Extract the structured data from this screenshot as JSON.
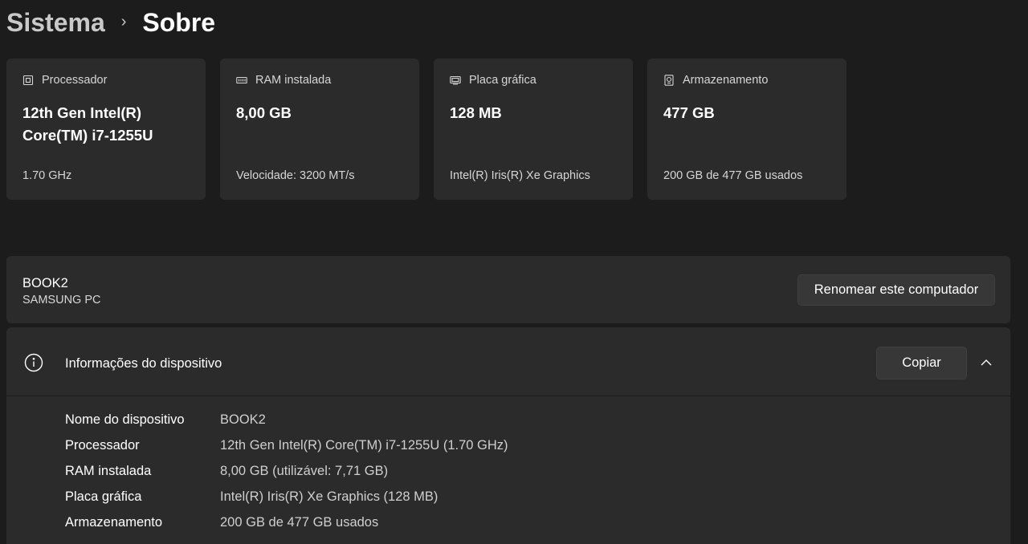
{
  "breadcrumb": {
    "parent": "Sistema",
    "separator": "›",
    "current": "Sobre"
  },
  "cards": [
    {
      "icon": "processor-icon",
      "label": "Processador",
      "value": "12th Gen Intel(R) Core(TM) i7-1255U",
      "sub": "1.70 GHz"
    },
    {
      "icon": "ram-icon",
      "label": "RAM instalada",
      "value": "8,00 GB",
      "sub": "Velocidade: 3200 MT/s"
    },
    {
      "icon": "graphics-card-icon",
      "label": "Placa gráfica",
      "value": "128 MB",
      "sub": "Intel(R) Iris(R) Xe Graphics"
    },
    {
      "icon": "storage-icon",
      "label": "Armazenamento",
      "value": "477 GB",
      "sub": "200 GB de 477 GB usados"
    }
  ],
  "pc": {
    "name": "BOOK2",
    "model": "SAMSUNG PC",
    "rename_label": "Renomear este computador"
  },
  "device_info": {
    "title": "Informações do dispositivo",
    "copy_label": "Copiar",
    "specs": [
      {
        "label": "Nome do dispositivo",
        "value": "BOOK2"
      },
      {
        "label": "Processador",
        "value": "12th Gen Intel(R) Core(TM) i7-1255U (1.70 GHz)"
      },
      {
        "label": "RAM instalada",
        "value": "8,00 GB (utilizável: 7,71 GB)"
      },
      {
        "label": "Placa gráfica",
        "value": "Intel(R) Iris(R) Xe Graphics (128 MB)"
      },
      {
        "label": "Armazenamento",
        "value": "200 GB de 477 GB usados"
      }
    ]
  },
  "colors": {
    "background": "#1c1c1c",
    "panel": "#2b2b2b",
    "button": "#373737"
  }
}
